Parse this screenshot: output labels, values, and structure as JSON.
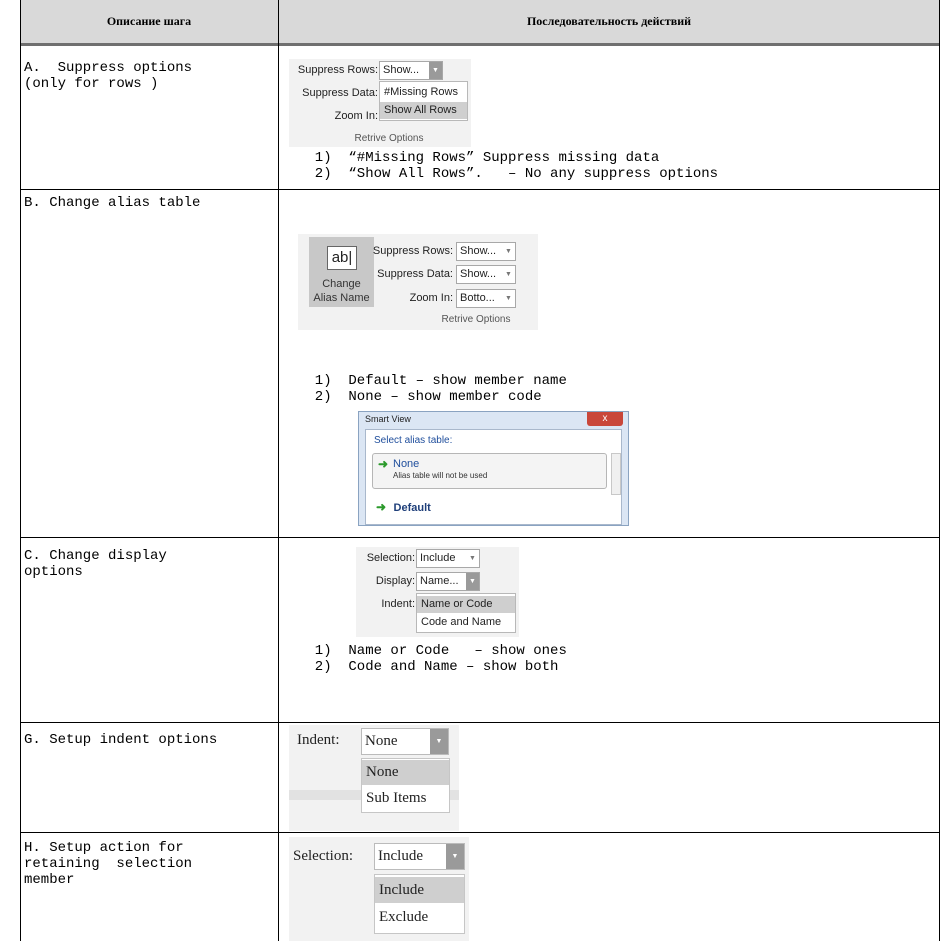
{
  "header": {
    "col1": "Описание шага",
    "col2": "Последовательность действий"
  },
  "rows": {
    "a": {
      "label": "A.  Suppress options\n(only for rows )",
      "ui": {
        "suppress_rows_label": "Suppress Rows:",
        "suppress_rows_value": "Show...",
        "suppress_data_label": "Suppress Data:",
        "zoom_in_label": "Zoom In:",
        "options": [
          "#Missing Rows",
          "Show All Rows"
        ],
        "selected_option": "Show All Rows",
        "group_label": "Retrive Options"
      },
      "notes": [
        "  1)  “#Missing Rows” Suppress missing data",
        "  2)  “Show All Rows”.   – No any suppress options"
      ]
    },
    "b": {
      "label": "B. Change alias table",
      "ui": {
        "button_icon_text": "ab|",
        "button_label": "Change\nAlias Name",
        "suppress_rows_label": "Suppress Rows:",
        "suppress_rows_value": "Show...",
        "suppress_data_label": "Suppress Data:",
        "suppress_data_value": "Show...",
        "zoom_in_label": "Zoom In:",
        "zoom_in_value": "Botto...",
        "group_label": "Retrive Options"
      },
      "notes": [
        "  1)  Default – show member name",
        "  2)  None – show member code"
      ],
      "dialog": {
        "title": "Smart View",
        "close": "x",
        "prompt": "Select alias table:",
        "item1_name": "None",
        "item1_desc": "Alias table will not be used",
        "item2_name": "Default"
      }
    },
    "c": {
      "label": "C. Change display\noptions",
      "ui": {
        "selection_label": "Selection:",
        "selection_value": "Include",
        "display_label": "Display:",
        "display_value": "Name...",
        "indent_label": "Indent:",
        "options": [
          "Name or Code",
          "Code and Name"
        ],
        "selected_option": "Name or Code"
      },
      "notes": [
        "  1)  Name or Code   – show ones",
        "  2)  Code and Name – show both"
      ]
    },
    "g": {
      "label": "G. Setup indent options",
      "ui": {
        "indent_label": "Indent:",
        "indent_value": "None",
        "options": [
          "None",
          "Sub Items"
        ],
        "selected_option": "None"
      }
    },
    "h": {
      "label": "H. Setup action for\nretaining  selection\nmember",
      "ui": {
        "selection_label": "Selection:",
        "selection_value": "Include",
        "options": [
          "Include",
          "Exclude"
        ],
        "selected_option": "Include"
      }
    }
  }
}
